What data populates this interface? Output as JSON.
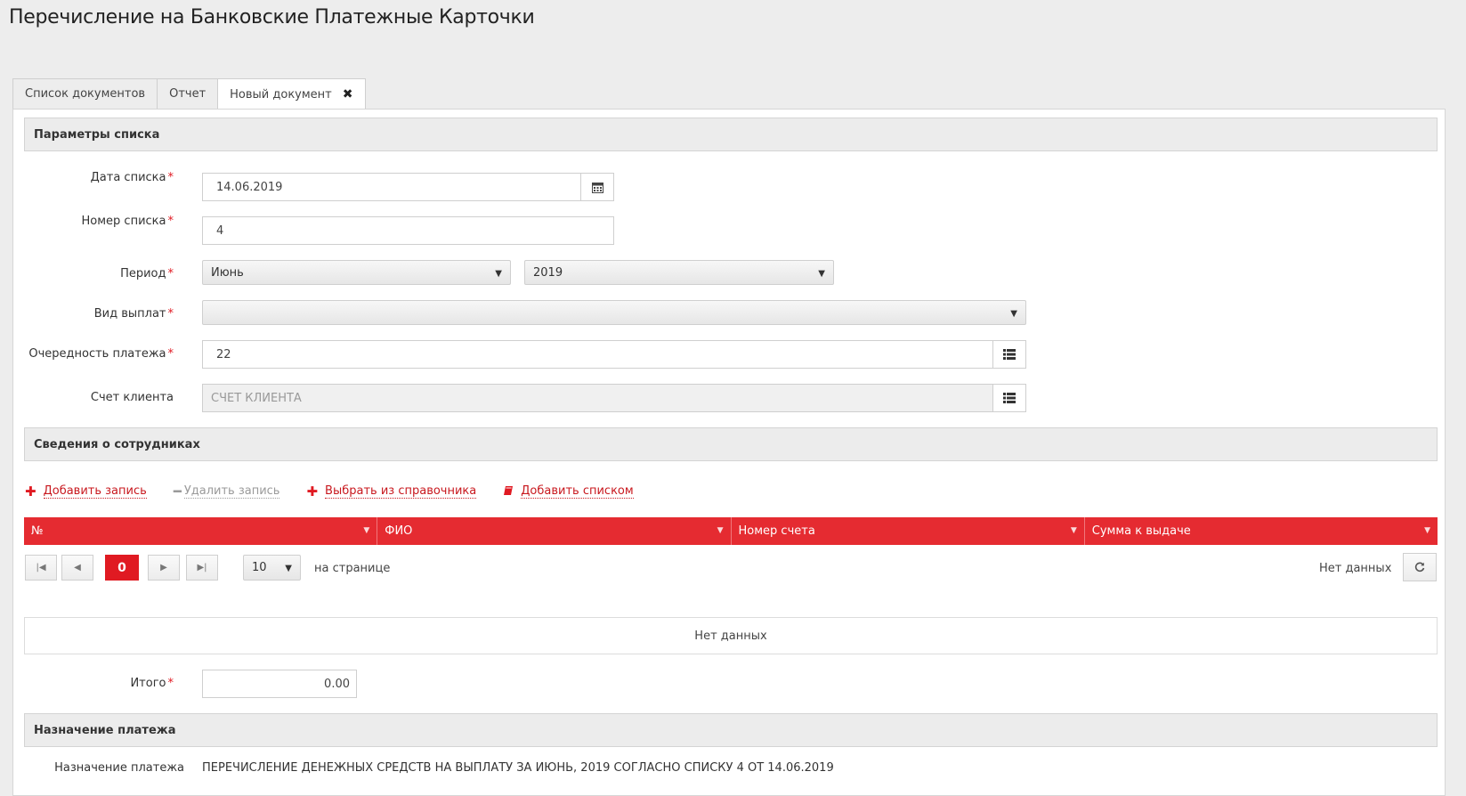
{
  "page": {
    "title": "Перечисление на Банковские Платежные Карточки"
  },
  "tabs": [
    {
      "label": "Список документов"
    },
    {
      "label": "Отчет"
    },
    {
      "label": "Новый документ"
    }
  ],
  "sections": {
    "params": "Параметры списка",
    "employees": "Сведения о сотрудниках",
    "purpose": "Назначение платежа"
  },
  "form": {
    "date": {
      "label": "Дата списка",
      "value": "14.06.2019"
    },
    "number": {
      "label": "Номер списка",
      "value": "4"
    },
    "period": {
      "label": "Период",
      "month": "Июнь",
      "year": "2019"
    },
    "payment_type": {
      "label": "Вид выплат",
      "value": ""
    },
    "priority": {
      "label": "Очередность платежа",
      "value": "22"
    },
    "account": {
      "label": "Счет клиента",
      "placeholder": "СЧЕТ КЛИЕНТА"
    },
    "total": {
      "label": "Итого",
      "value": "0.00"
    },
    "purpose": {
      "label": "Назначение платежа",
      "value": "ПЕРЕЧИСЛЕНИЕ ДЕНЕЖНЫХ СРЕДСТВ НА ВЫПЛАТУ ЗА ИЮНЬ, 2019 СОГЛАСНО СПИСКУ 4 ОТ 14.06.2019"
    }
  },
  "actions": {
    "add": "Добавить запись",
    "delete": "Удалить запись",
    "pick": "Выбрать из справочника",
    "add_list": "Добавить списком"
  },
  "grid": {
    "columns": [
      "№",
      "ФИО",
      "Номер счета",
      "Сумма к выдаче"
    ],
    "current_page": "0",
    "page_size": "10",
    "per_page_label": "на странице",
    "status": "Нет данных",
    "empty_text": "Нет данных"
  },
  "colors": {
    "accent": "#e01a22",
    "header_bg": "#e52b31"
  },
  "icons": [
    "calendar-icon",
    "list-icon",
    "plus-icon",
    "minus-icon",
    "book-icon",
    "refresh-icon",
    "close-icon"
  ]
}
